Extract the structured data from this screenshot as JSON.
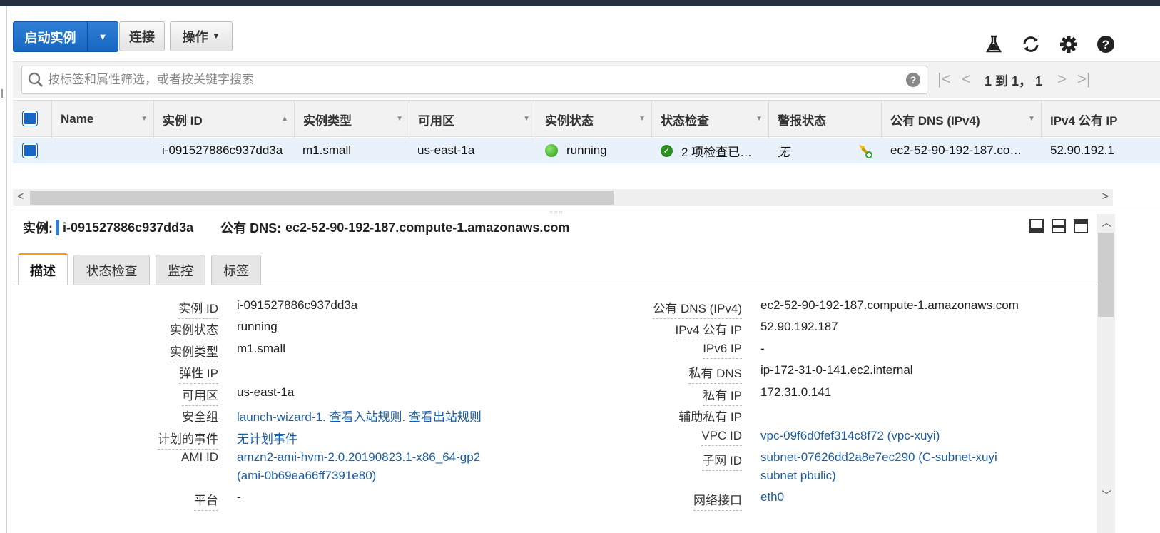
{
  "toolbar": {
    "launch_label": "启动实例",
    "connect_label": "连接",
    "actions_label": "操作"
  },
  "search": {
    "placeholder": "按标签和属性筛选，或者按关键字搜索"
  },
  "pager": {
    "text": "1 到 1， 1"
  },
  "table": {
    "columns": [
      "Name",
      "实例 ID",
      "实例类型",
      "可用区",
      "实例状态",
      "状态检查",
      "警报状态",
      "公有 DNS (IPv4)",
      "IPv4 公有 IP"
    ],
    "row": {
      "name": "",
      "instance_id": "i-091527886c937dd3a",
      "instance_type": "m1.small",
      "az": "us-east-1a",
      "state": "running",
      "status_check": "2 项检查已…",
      "alarm": "无",
      "public_dns": "ec2-52-90-192-187.co…",
      "public_ip": "52.90.192.1"
    }
  },
  "detail": {
    "instance_label": "实例:",
    "instance_id": "i-091527886c937dd3a",
    "dns_label": "公有 DNS:",
    "dns_value": "ec2-52-90-192-187.compute-1.amazonaws.com",
    "tabs": [
      "描述",
      "状态检查",
      "监控",
      "标签"
    ],
    "left": [
      {
        "label": "实例 ID",
        "value": "i-091527886c937dd3a"
      },
      {
        "label": "实例状态",
        "value": "running"
      },
      {
        "label": "实例类型",
        "value": "m1.small"
      },
      {
        "label": "弹性 IP",
        "value": ""
      },
      {
        "label": "可用区",
        "value": "us-east-1a"
      },
      {
        "label": "安全组",
        "value": "launch-wizard-1. 查看入站规则. 查看出站规则"
      },
      {
        "label": "计划的事件",
        "value": "无计划事件"
      },
      {
        "label": "AMI ID",
        "value": "amzn2-ami-hvm-2.0.20190823.1-x86_64-gp2",
        "value2": "(ami-0b69ea66ff7391e80)"
      },
      {
        "label": "平台",
        "value": "-"
      }
    ],
    "right": [
      {
        "label": "公有 DNS (IPv4)",
        "value": "ec2-52-90-192-187.compute-1.amazonaws.com"
      },
      {
        "label": "IPv4 公有 IP",
        "value": "52.90.192.187"
      },
      {
        "label": "IPv6 IP",
        "value": "-"
      },
      {
        "label": "私有 DNS",
        "value": "ip-172-31-0-141.ec2.internal"
      },
      {
        "label": "私有 IP",
        "value": "172.31.0.141"
      },
      {
        "label": "辅助私有 IP",
        "value": ""
      },
      {
        "label": "VPC ID",
        "value": "vpc-09f6d0fef314c8f72 (vpc-xuyi)"
      },
      {
        "label": "子网 ID",
        "value": "subnet-07626dd2a8e7ec290 (C-subnet-xuyi",
        "value2": "subnet pbulic)"
      },
      {
        "label": "网络接口",
        "value": "eth0"
      }
    ]
  },
  "colors": {
    "primary": "#1667c2",
    "link": "#1a5ea8",
    "active_tab": "#ff9900",
    "topbar": "#232f3e"
  }
}
